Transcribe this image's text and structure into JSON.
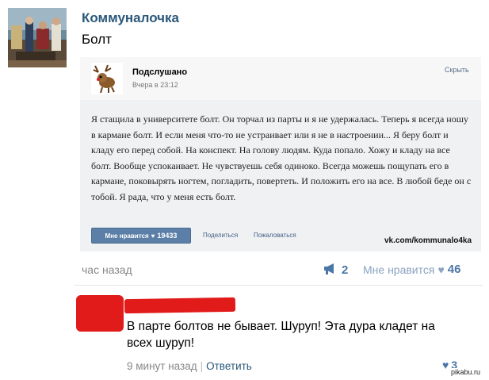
{
  "post": {
    "group_name": "Коммуналочка",
    "title": "Болт",
    "time": "час назад",
    "reposts": "2",
    "likes_label": "Мне нравится",
    "likes": "46"
  },
  "embed": {
    "source_name": "Подслушано",
    "source_time": "Вчера в 23:12",
    "hide_label": "Скрыть",
    "text": "Я стащила в университете болт. Он торчал из парты и я не удержалась. Теперь я всегда ношу в кармане болт. И если меня что-то не устраивает или я не в настроении... Я беру болт и кладу его перед собой. На конспект. На голову людям. Куда попало. Хожу и кладу на все болт. Вообще успокаивает. Не чувствуешь себя одиноко. Всегда можешь пощупать его в кармане, поковырять ногтем, погладить, повертеть. И положить его на все. В любой беде он с тобой. Я рада, что у меня есть болт.",
    "like_label": "Мне нравится",
    "like_count": "19433",
    "share_label": "Поделиться",
    "report_label": "Пожаловаться",
    "watermark": "vk.com/kommunalo4ka"
  },
  "comment": {
    "text": "В парте болтов не бывает. Шуруп! Эта дура кладет на всех шуруп!",
    "time": "9 минут назад",
    "reply_label": "Ответить",
    "likes": "3"
  },
  "site_watermark": "pikabu.ru",
  "colors": {
    "link": "#2b587a",
    "accent": "#4a76a8",
    "redaction": "#e11a1a"
  }
}
